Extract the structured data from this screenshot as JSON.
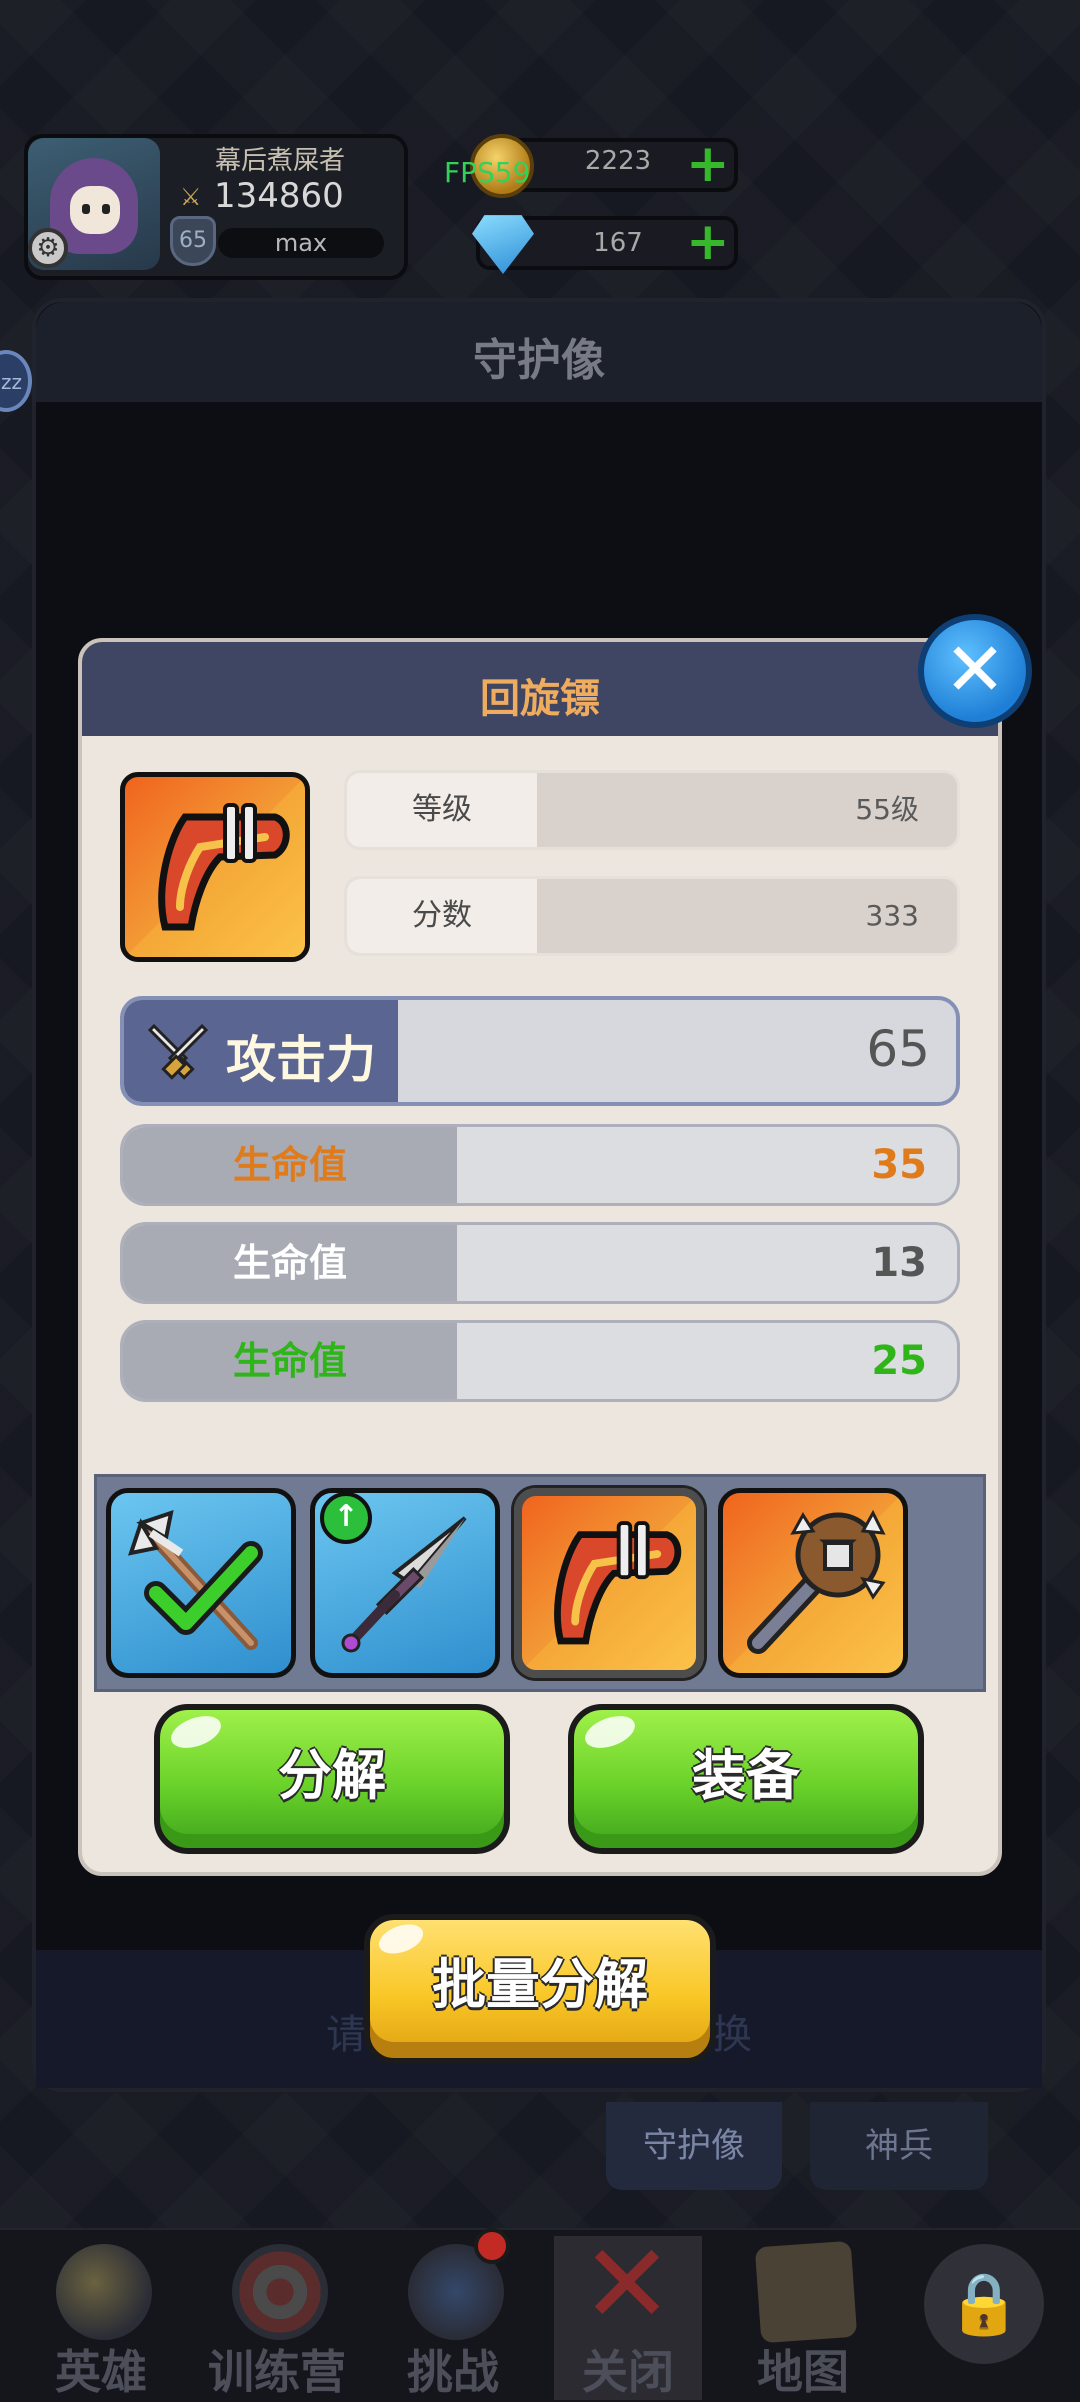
{
  "header": {
    "player_name": "幕后煮屎者",
    "power": "134860",
    "level": "65",
    "exp_text": "max",
    "fps": "FPS59",
    "gold": "2223",
    "gems": "167"
  },
  "background_panel": {
    "title": "守护像",
    "hint_left": "请",
    "hint_right": "换",
    "tabs": [
      "守护像",
      "神兵"
    ],
    "side_badge": "zz"
  },
  "dialog": {
    "title": "回旋镖",
    "stats": [
      {
        "label": "等级",
        "value": "55级"
      },
      {
        "label": "分数",
        "value": "333"
      }
    ],
    "attack": {
      "label": "攻击力",
      "value": "65"
    },
    "hp_rows": [
      {
        "label": "生命值",
        "value": "35",
        "color": "#e07b1c"
      },
      {
        "label": "生命值",
        "value": "13",
        "color": "#ffffff"
      },
      {
        "label": "生命值",
        "value": "25",
        "color": "#2fb51a"
      }
    ],
    "inventory": [
      {
        "icon": "trident-icon",
        "rarity": "blue",
        "equipped": true,
        "upgrade": false
      },
      {
        "icon": "dagger-icon",
        "rarity": "blue",
        "equipped": false,
        "upgrade": true
      },
      {
        "icon": "boomerang-icon",
        "rarity": "orange",
        "selected": true
      },
      {
        "icon": "spiked-mace-icon",
        "rarity": "orange",
        "selected": false
      }
    ],
    "buttons": {
      "decompose": "分解",
      "equip": "装备",
      "batch_decompose": "批量分解"
    },
    "close_symbol": "✕"
  },
  "bottom_nav": [
    {
      "label": "英雄",
      "icon": "heroes-icon"
    },
    {
      "label": "训练营",
      "icon": "training-target-icon"
    },
    {
      "label": "挑战",
      "icon": "sword-shield-icon"
    },
    {
      "label": "关闭",
      "icon": "close-x-icon",
      "active": true
    },
    {
      "label": "地图",
      "icon": "map-icon"
    },
    {
      "label": "",
      "icon": "lock-icon"
    }
  ]
}
